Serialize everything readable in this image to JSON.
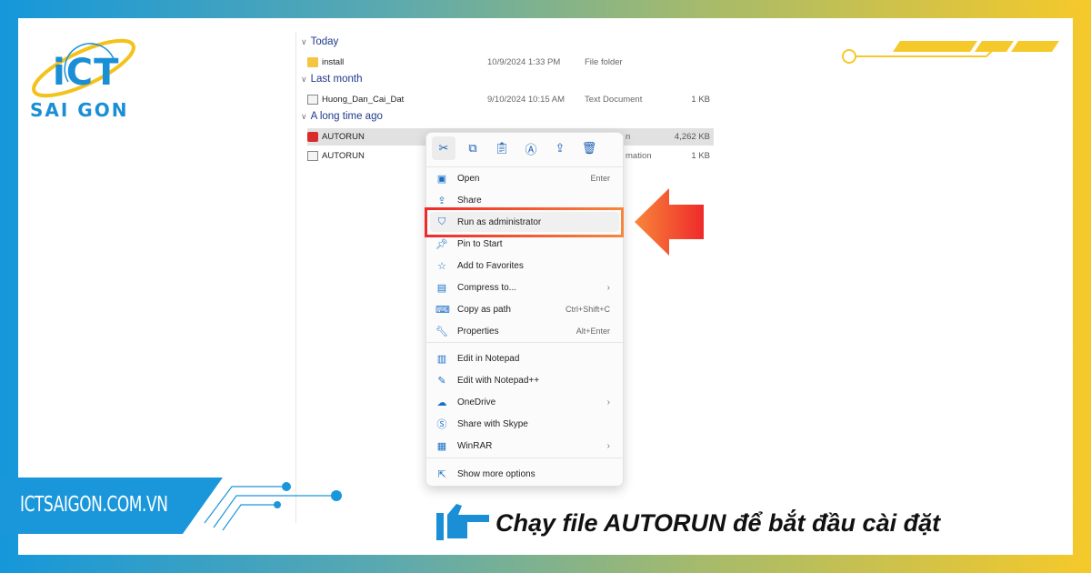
{
  "brand": {
    "logo_top": "iCT",
    "logo_bottom": "SAI GON",
    "website": "ICTSAIGON.COM.VN",
    "colors": {
      "blue": "#1a97db",
      "yellow": "#f6c92a",
      "highlight": "#ee2a2a"
    }
  },
  "explorer": {
    "groups": [
      {
        "label": "Today"
      },
      {
        "label": "Last month"
      },
      {
        "label": "A long time ago"
      }
    ],
    "files": [
      {
        "name": "install",
        "date": "10/9/2024 1:33 PM",
        "type": "File folder",
        "size": "",
        "icon": "folder-icon"
      },
      {
        "name": "Huong_Dan_Cai_Dat",
        "date": "9/10/2024 10:15 AM",
        "type": "Text Document",
        "size": "1 KB",
        "icon": "text-file-icon"
      },
      {
        "name": "AUTORUN",
        "date": "",
        "type": "n",
        "size": "4,262 KB",
        "icon": "app-icon",
        "selected": true
      },
      {
        "name": "AUTORUN",
        "date": "",
        "type": "mation",
        "size": "1 KB",
        "icon": "setup-info-icon"
      }
    ]
  },
  "context_menu": {
    "toolbar": [
      "cut-icon",
      "copy-icon",
      "paste-icon",
      "rename-icon",
      "share-icon",
      "delete-icon"
    ],
    "items": [
      {
        "label": "Open",
        "shortcut": "Enter",
        "icon": "open-icon"
      },
      {
        "label": "Share",
        "shortcut": "",
        "icon": "share-icon"
      },
      {
        "label": "Run as administrator",
        "shortcut": "",
        "icon": "shield-icon",
        "highlighted": true
      },
      {
        "label": "Pin to Start",
        "shortcut": "",
        "icon": "pin-icon"
      },
      {
        "label": "Add to Favorites",
        "shortcut": "",
        "icon": "star-icon"
      },
      {
        "label": "Compress to...",
        "shortcut": "",
        "icon": "zip-icon",
        "submenu": true
      },
      {
        "label": "Copy as path",
        "shortcut": "Ctrl+Shift+C",
        "icon": "path-icon"
      },
      {
        "label": "Properties",
        "shortcut": "Alt+Enter",
        "icon": "wrench-icon"
      },
      {
        "label": "Edit in Notepad",
        "shortcut": "",
        "icon": "notepad-icon"
      },
      {
        "label": "Edit with Notepad++",
        "shortcut": "",
        "icon": "notepadpp-icon"
      },
      {
        "label": "OneDrive",
        "shortcut": "",
        "icon": "cloud-icon",
        "submenu": true
      },
      {
        "label": "Share with Skype",
        "shortcut": "",
        "icon": "skype-icon"
      },
      {
        "label": "WinRAR",
        "shortcut": "",
        "icon": "winrar-icon",
        "submenu": true
      },
      {
        "label": "Show more options",
        "shortcut": "",
        "icon": "more-options-icon"
      }
    ]
  },
  "caption": "Chạy file AUTORUN để bắt đầu cài đặt"
}
